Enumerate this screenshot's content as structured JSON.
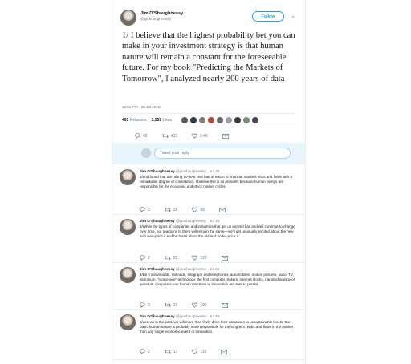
{
  "main_tweet": {
    "author": "Jim O'Shaughnessy",
    "handle": "@jposhaughnessy",
    "follow_label": "Follow",
    "text": "1/ I believe that the highest probability bet you can make in your investment strategy is that human nature will remain a constant for the foreseeable future. For my book \"Predicting the Markets of Tomorrow\", I analyzed nearly 200 years of data",
    "timestamp": "12:01 PM - 26 Jul 2018",
    "retweets_count": "403",
    "retweets_label": "Retweets",
    "likes_count": "1,359",
    "likes_label": "Likes",
    "reply_count": "42",
    "retweet_count": "403",
    "like_count": "3.4K"
  },
  "reply_box": {
    "placeholder": "Tweet your reply"
  },
  "thread": [
    {
      "author": "Jim O'Shaughnessy",
      "handle": "@jposhaughnessy",
      "date": "Jul 26",
      "text": "2/and found that the rolling 20-year real rate of return to financial markets ebbs and flows with a remarkable degree of consistency. I believe this is so primarily because human beings are responsible for the economic and stock market cycles.",
      "replies": "3",
      "retweets": "28",
      "likes": "99"
    },
    {
      "author": "Jim O'Shaughnessy",
      "handle": "@jposhaughnessy",
      "date": "Jul 26",
      "text": "3/While the types of companies and industries that get us excited has and will continue to change over time, our reactions to them will remain the same—we'll get unusually excited about the new and over-price it and be blasé about the old and under-price it.",
      "replies": "2",
      "retweets": "22",
      "likes": "122"
    },
    {
      "author": "Jim O'Shaughnessy",
      "handle": "@jposhaughnessy",
      "date": "Jul 26",
      "text": "4/Be it steamboats, railroads, telegraph and telephones, automobiles, motion pictures, radio, TV, aluminum, \"space-age\" technology, the first computer makers, internet stocks, nanotechnology or quantum computers, our human reactions to innovation are sure to persist.",
      "replies": "3",
      "retweets": "19",
      "likes": "102"
    },
    {
      "author": "Jim O'Shaughnessy",
      "handle": "@jposhaughnessy",
      "date": "Jul 26",
      "text": "5/Just as in the past, we will more than likely drive their valuations to unsustainable levels. Our basic human nature is probably more responsible for the long-term ebbs and flows in the market than any single economic event or innovation.",
      "replies": "2",
      "retweets": "17",
      "likes": "116"
    }
  ]
}
